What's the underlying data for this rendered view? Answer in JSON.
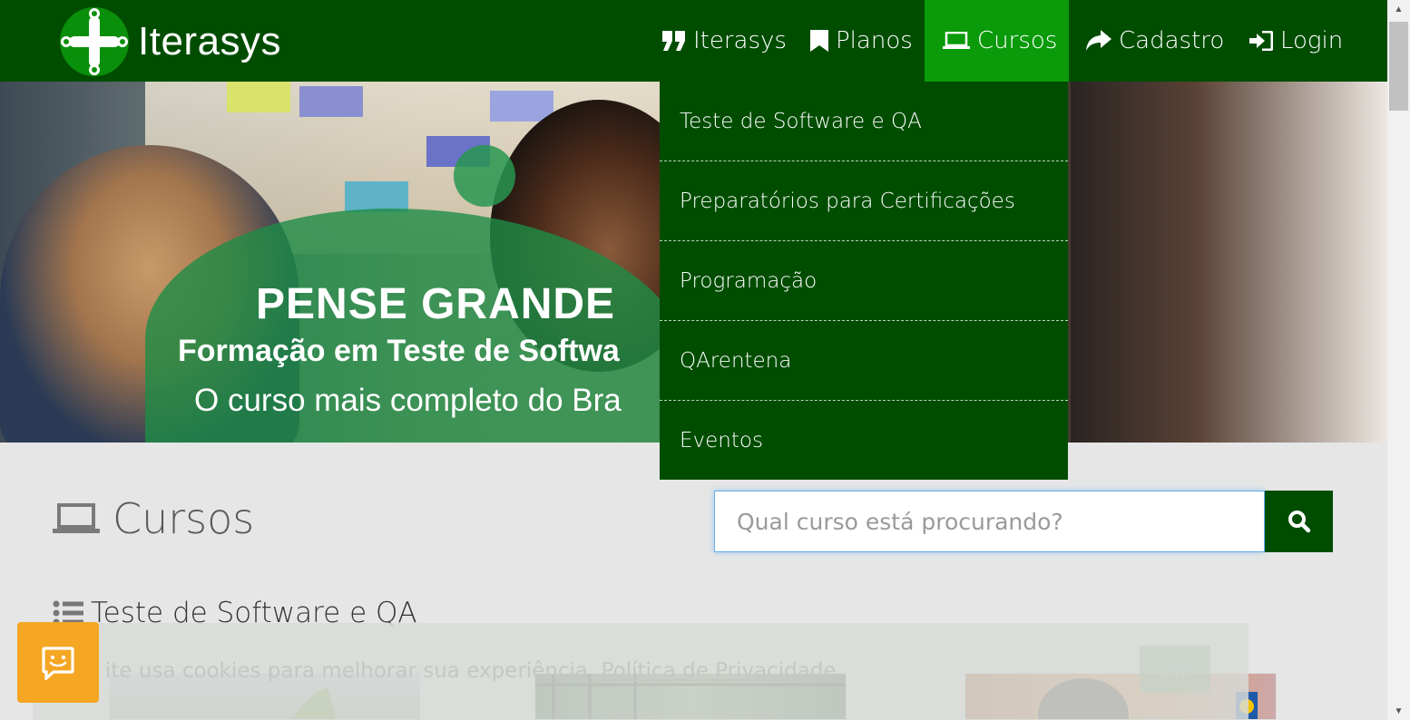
{
  "brand": {
    "name": "Iterasys"
  },
  "nav": {
    "items": [
      {
        "label": "Iterasys",
        "icon": "quote-icon"
      },
      {
        "label": "Planos",
        "icon": "bookmark-icon"
      },
      {
        "label": "Cursos",
        "icon": "laptop-icon",
        "active": true
      },
      {
        "label": "Cadastro",
        "icon": "share-icon"
      },
      {
        "label": "Login",
        "icon": "sign-in-icon"
      }
    ]
  },
  "dropdown": {
    "items": [
      "Teste de Software e QA",
      "Preparatórios para Certificações",
      "Programação",
      "QArentena",
      "Eventos"
    ]
  },
  "hero": {
    "headline": "PENSE GRANDE",
    "subheadline": "Formação em Teste de Softwa",
    "tagline": "O curso mais completo do Bra"
  },
  "main": {
    "title": "Cursos",
    "category": "Teste de Software e QA"
  },
  "search": {
    "placeholder": "Qual curso está procurando?"
  },
  "cookie": {
    "text": "ite usa cookies para melhorar sua experiência.",
    "link": "Política de Privacidade",
    "button": "Ok!"
  },
  "colors": {
    "primary": "#004d00",
    "active": "#0a9a0a",
    "chat": "#f5a623"
  }
}
